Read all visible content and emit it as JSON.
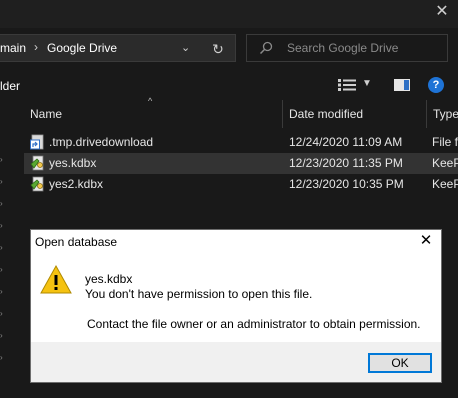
{
  "window": {
    "close_glyph": "✕"
  },
  "address_bar": {
    "breadcrumb": [
      "main",
      "Google Drive"
    ],
    "separator": "›",
    "dropdown_glyph": "⌄",
    "refresh_glyph": "↻"
  },
  "search": {
    "placeholder": "Search Google Drive"
  },
  "toolbar": {
    "pane_label": "lder",
    "help_glyph": "?"
  },
  "columns": [
    {
      "label": "Name"
    },
    {
      "label": "Date modified"
    },
    {
      "label": "Type"
    }
  ],
  "files": [
    {
      "name": ".tmp.drivedownload",
      "date": "12/24/2020 11:09 AM",
      "type": "File f",
      "icon": "folder-shortcut-icon",
      "selected": false
    },
    {
      "name": "yes.kdbx",
      "date": "12/23/2020 11:35 PM",
      "type": "KeeP",
      "icon": "keepass-file-icon",
      "selected": true
    },
    {
      "name": "yes2.kdbx",
      "date": "12/23/2020 10:35 PM",
      "type": "KeeP",
      "icon": "keepass-file-icon",
      "selected": false
    }
  ],
  "dialog": {
    "title": "Open database",
    "close_glyph": "✕",
    "filename": "yes.kdbx",
    "message": "You don't have permission to open this file.",
    "hint": "Contact the file owner or an administrator to obtain permission.",
    "ok_label": "OK",
    "icon": "warning-icon"
  },
  "colors": {
    "background": "#191919",
    "selected_row": "#333333",
    "accent": "#0078d7",
    "help": "#1e73d6",
    "warning": "#f5c211"
  }
}
